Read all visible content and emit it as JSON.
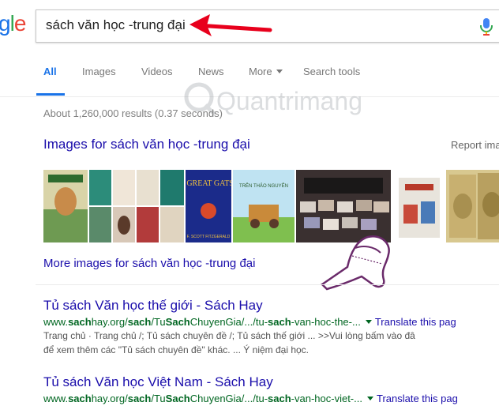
{
  "logo": {
    "text_g": "g",
    "text_l": "l",
    "text_e": "e"
  },
  "search": {
    "query": "sách văn học -trung đại"
  },
  "tabs": [
    {
      "label": "All"
    },
    {
      "label": "Images"
    },
    {
      "label": "Videos"
    },
    {
      "label": "News"
    },
    {
      "label": "More"
    },
    {
      "label": "Search tools"
    }
  ],
  "stats": "About 1,260,000 results (0.37 seconds)",
  "images_section": {
    "heading": "Images for sách văn học -trung đại",
    "report": "Report ima",
    "more": "More images for sách văn học -trung đại",
    "thumb_captions": {
      "gatsby_title": "The GREAT GATSBY",
      "gatsby_author": "F. SCOTT FITZGERALD",
      "book3_title": "TRÊN THẢO NGUYÊN"
    }
  },
  "watermark": "Quantrimang",
  "results": [
    {
      "title": "Tủ sách Văn học thế giới - Sách Hay",
      "url_parts": [
        "www.",
        "sach",
        "hay.org/",
        "sach",
        "/Tu",
        "Sach",
        "ChuyenGia/.../tu-",
        "sach",
        "-van-hoc-the-..."
      ],
      "translate": "Translate this pag",
      "snippet1": "Trang chủ · Trang chủ /; Tủ sách chuyên đề /; Tủ sách thế giới ... >>Vui lòng bấm vào đâ",
      "snippet2": "để xem thêm các \"Tủ sách chuyên đề\" khác. ... Ý niệm đại học."
    },
    {
      "title": "Tủ sách Văn học Việt Nam - Sách Hay",
      "url_parts": [
        "www.",
        "sach",
        "hay.org/",
        "sach",
        "/Tu",
        "Sach",
        "ChuyenGia/.../tu-",
        "sach",
        "-van-hoc-viet-..."
      ],
      "translate": "Translate this pag",
      "snippet1": "",
      "snippet2": ""
    }
  ],
  "colors": {
    "link": "#1a0dab",
    "url": "#006621",
    "accent": "#1a73e8",
    "arrow": "#e8001c"
  }
}
